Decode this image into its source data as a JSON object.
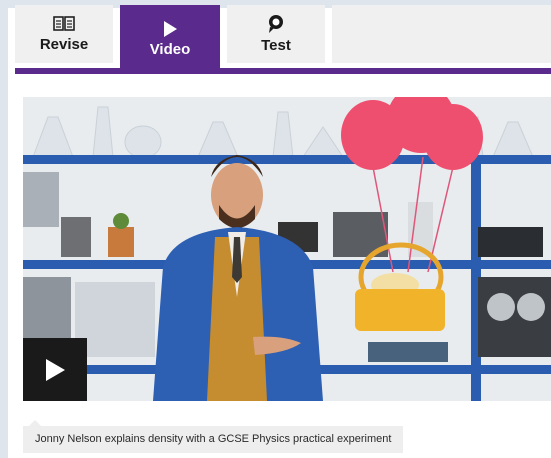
{
  "tabs": {
    "revise": {
      "label": "Revise",
      "icon": "open-book-icon"
    },
    "video": {
      "label": "Video",
      "icon": "play-icon"
    },
    "test": {
      "label": "Test",
      "icon": "magnifier-icon"
    }
  },
  "active_tab": "video",
  "video": {
    "caption": "Jonny Nelson explains density with a GCSE Physics practical experiment"
  },
  "colors": {
    "accent": "#5a2a8c",
    "tab_bg": "#f0f0f0",
    "play_bg": "#1a1a1a",
    "caption_bg": "#eeeeee"
  }
}
